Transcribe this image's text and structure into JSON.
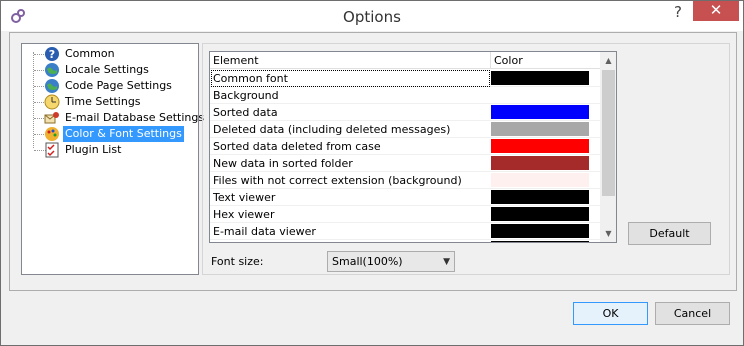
{
  "window": {
    "title": "Options",
    "help_glyph": "?",
    "close_glyph": "✕"
  },
  "tree": {
    "items": [
      {
        "label": "Common",
        "icon": "help-icon"
      },
      {
        "label": "Locale Settings",
        "icon": "globe-icon"
      },
      {
        "label": "Code Page Settings",
        "icon": "globe-icon"
      },
      {
        "label": "Time Settings",
        "icon": "clock-icon"
      },
      {
        "label": "E-mail Database Settings",
        "icon": "email-database-icon"
      },
      {
        "label": "Color & Font Settings",
        "icon": "palette-icon",
        "selected": true
      },
      {
        "label": "Plugin List",
        "icon": "checklist-icon"
      }
    ]
  },
  "table": {
    "columns": [
      "Element",
      "Color"
    ],
    "rows": [
      {
        "element": "Common font",
        "color": "#000000"
      },
      {
        "element": "Background",
        "color": "#ffffff"
      },
      {
        "element": "Sorted data",
        "color": "#0000ff"
      },
      {
        "element": "Deleted data (including deleted messages)",
        "color": "#a8a8a8"
      },
      {
        "element": "Sorted data deleted from case",
        "color": "#ff0000"
      },
      {
        "element": "New data in sorted folder",
        "color": "#a52a2a"
      },
      {
        "element": "Files with not correct extension (background)",
        "color": "#fff0f0"
      },
      {
        "element": "Text viewer",
        "color": "#000000"
      },
      {
        "element": "Hex viewer",
        "color": "#000000"
      },
      {
        "element": "E-mail data viewer",
        "color": "#000000"
      },
      {
        "element": "",
        "color": "#000000"
      }
    ]
  },
  "font_size": {
    "label": "Font size:",
    "value": "Small(100%)"
  },
  "buttons": {
    "default_label": "Default",
    "ok_label": "OK",
    "cancel_label": "Cancel"
  }
}
